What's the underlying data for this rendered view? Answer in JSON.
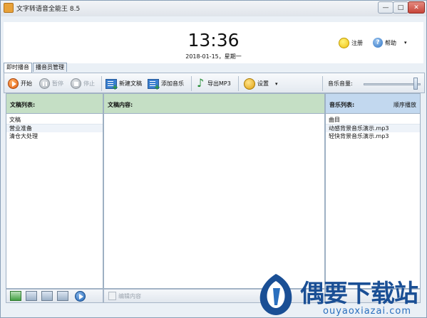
{
  "window": {
    "title": "文字转语音全能王 8.5",
    "min_symbol": "—",
    "max_symbol": "□",
    "close_symbol": "✕"
  },
  "header": {
    "time": "13:36",
    "date": "2018-01-15，星期一",
    "register_label": "注册",
    "help_label": "帮助",
    "help_icon_glyph": "?",
    "help_caret": "▾"
  },
  "tabs": [
    {
      "label": "即时播音",
      "active": true
    },
    {
      "label": "播音员管理",
      "active": false
    }
  ],
  "toolbar": {
    "start_label": "开始",
    "pause_label": "暂停",
    "stop_label": "停止",
    "new_doc_label": "新建文稿",
    "add_music_label": "添加音乐",
    "export_label": "导出MP3",
    "settings_label": "设置",
    "settings_caret": "▾",
    "volume_label": "音乐音量:",
    "volume_level": 0.95
  },
  "left_panel": {
    "title": "文稿列表:",
    "column_header": "文稿",
    "items": [
      "营业准备",
      "清仓大处理"
    ]
  },
  "mid_panel": {
    "title": "文稿内容:",
    "edit_label": "编辑内容"
  },
  "right_panel": {
    "title": "音乐列表:",
    "play_mode": "顺序播放",
    "column_header": "曲目",
    "items": [
      "动感背景音乐演示.mp3",
      "轻快背景音乐演示.mp3"
    ]
  },
  "watermark": {
    "text": "偶要下载站",
    "url": "ouyaoxiazai.com"
  },
  "icons": {
    "start": "play-icon",
    "pause": "pause-icon",
    "stop": "stop-icon",
    "new_doc": "new-document-icon",
    "add_music": "add-music-icon",
    "export": "music-note-icon",
    "settings": "gear-icon",
    "register": "smiley-icon",
    "help": "help-icon"
  },
  "colors": {
    "doc_panel_header": "#c5dfc5",
    "music_panel_header": "#c2d8ef",
    "accent_orange": "#e25d10",
    "accent_blue": "#1f63b5"
  }
}
